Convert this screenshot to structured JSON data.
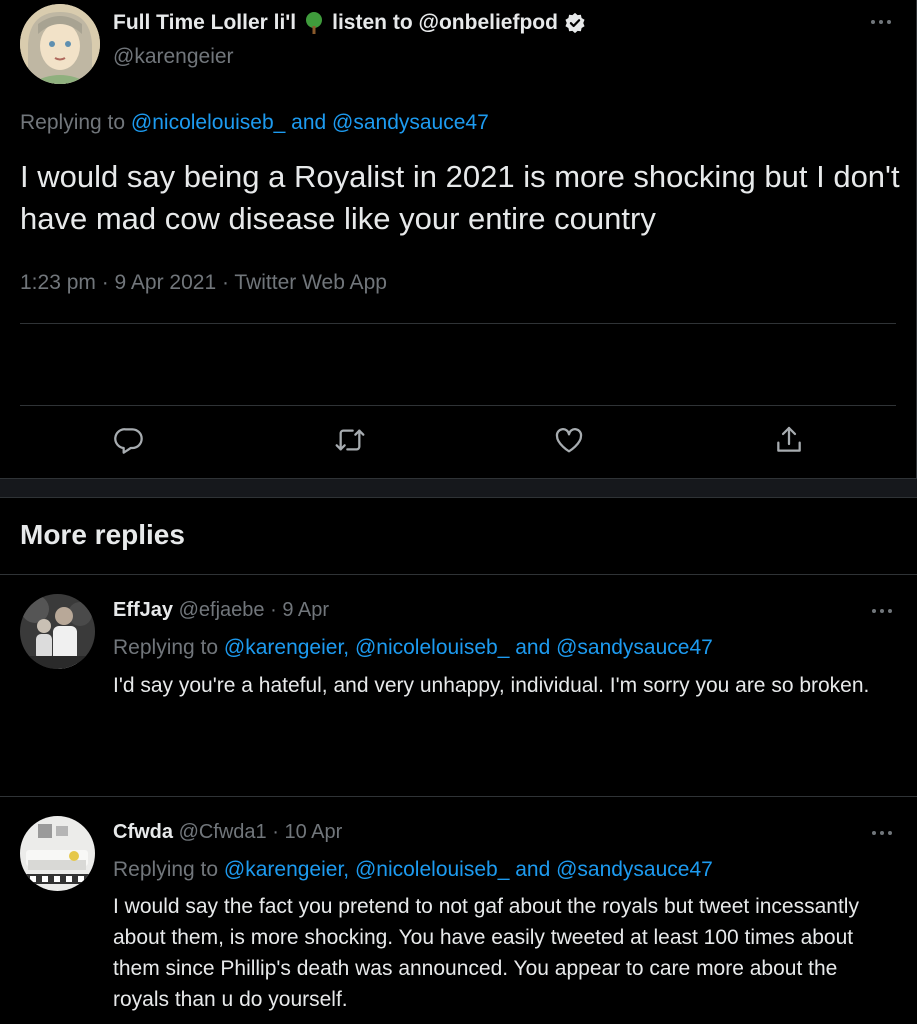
{
  "main_tweet": {
    "display_name_part1": "Full Time Loller li'l",
    "display_name_part2": "listen to @onbeliefpod",
    "handle": "@karengeier",
    "replying_label": "Replying to",
    "replying_to": "@nicolelouiseb_ and @sandysauce47",
    "text": "I would say being a Royalist in 2021 is more shocking but I don't have mad cow disease like your entire country",
    "timestamp": "1:23 pm · 9 Apr 2021 · Twitter Web App",
    "icons": {
      "more": "more-icon",
      "tree": "tree-icon",
      "verified": "verified-icon",
      "reply": "reply-icon",
      "retweet": "retweet-icon",
      "like": "like-icon",
      "share": "share-icon"
    }
  },
  "section_title": "More replies",
  "replies": [
    {
      "name": "EffJay",
      "handle": "@efjaebe",
      "date": "9 Apr",
      "replying_label": "Replying to",
      "replying_to": "@karengeier, @nicolelouiseb_ and @sandysauce47",
      "text": "I'd say you're a hateful, and very unhappy, individual. I'm sorry you are so broken."
    },
    {
      "name": "Cfwda",
      "handle": "@Cfwda1",
      "date": "10 Apr",
      "replying_label": "Replying to",
      "replying_to": "@karengeier, @nicolelouiseb_ and @sandysauce47",
      "text": "I would say the fact you pretend to not gaf about the royals but tweet incessantly about them, is more shocking.  You have easily tweeted at least 100 times about them since Phillip's death was announced. You appear to care more about the royals than u do yourself."
    }
  ],
  "colors": {
    "background": "#000000",
    "text": "#e7e9ea",
    "muted": "#71767b",
    "link": "#1d9bf0",
    "divider": "#2f3336"
  }
}
